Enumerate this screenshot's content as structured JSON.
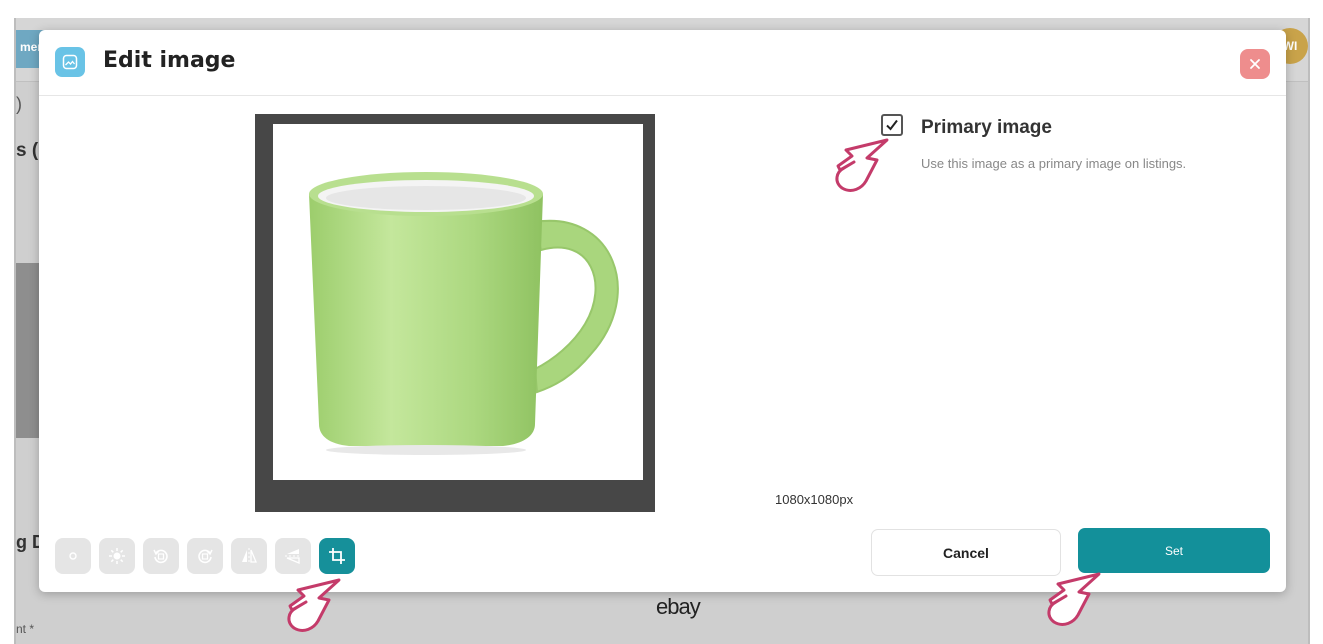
{
  "background": {
    "tab_label": "mer",
    "avatar_initials": "WI",
    "text_paren": ")",
    "text_s": "s (",
    "text_gd": "g D",
    "text_nt": "nt *",
    "logo_text": "ebay"
  },
  "modal": {
    "title": "Edit image",
    "close_icon": "close-icon",
    "header_icon": "image-icon"
  },
  "primary_image": {
    "label": "Primary image",
    "description": "Use this image as a primary image on listings.",
    "checked": true
  },
  "image": {
    "dimensions": "1080x1080px",
    "subject": "mug-image"
  },
  "toolbar": {
    "tools": [
      {
        "icon": "dot-icon",
        "active": false
      },
      {
        "icon": "brightness-icon",
        "active": false
      },
      {
        "icon": "rotate-left-icon",
        "active": false
      },
      {
        "icon": "rotate-right-icon",
        "active": false
      },
      {
        "icon": "flip-horizontal-icon",
        "active": false
      },
      {
        "icon": "flip-vertical-icon",
        "active": false
      },
      {
        "icon": "crop-icon",
        "active": true
      }
    ]
  },
  "buttons": {
    "cancel_label": "Cancel",
    "set_label": "Set"
  },
  "colors": {
    "accent": "#13909a",
    "close": "#ee8d8d",
    "header_icon": "#69c3e6",
    "cursor": "#c43b6a"
  }
}
